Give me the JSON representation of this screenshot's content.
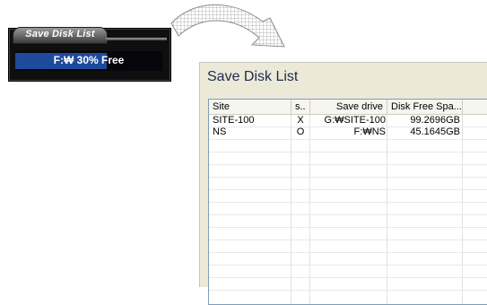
{
  "widget": {
    "title": "Save Disk List",
    "bar_text": "F:₩ 30% Free",
    "progress_fraction": 0.62
  },
  "window": {
    "title": "Save Disk List",
    "columns": [
      "Site",
      "s..",
      "Save drive",
      "Disk Free Spa..."
    ],
    "rows": [
      {
        "site": "SITE-100",
        "status": "X",
        "drive": "G:₩SITE-100",
        "free": "99.2696GB"
      },
      {
        "site": "NS",
        "status": "O",
        "drive": "F:₩NS",
        "free": "45.1645GB"
      }
    ]
  },
  "colors": {
    "widget_bg": "#0f0f0f",
    "bar_fill": "#1d4a9c",
    "window_bg": "#ece9d8",
    "title_text": "#1c2b4e"
  },
  "icons": {
    "arrow": "curved-arrow-icon"
  }
}
